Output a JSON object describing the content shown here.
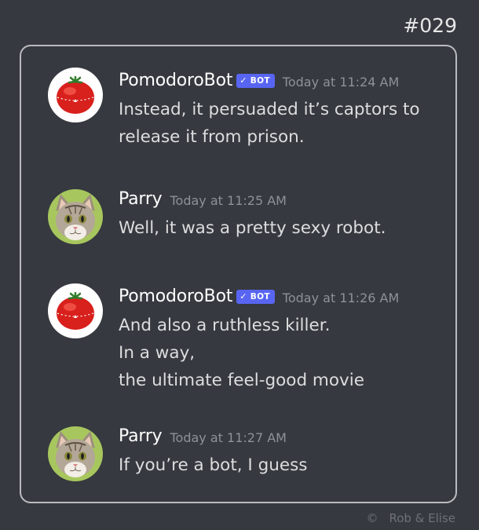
{
  "comic_number": "#029",
  "copyright": {
    "symbol": "©",
    "credit": "Rob & Elise"
  },
  "bot_tag": {
    "check": "✓",
    "label": "BOT"
  },
  "colors": {
    "background": "#36393f",
    "panel_border": "#b9bbbe",
    "bot_tag": "#5865f2",
    "timestamp": "#8e9297",
    "message_text": "#dcddde"
  },
  "messages": [
    {
      "author": "PomodoroBot",
      "is_bot": true,
      "avatar": "tomato-timer-avatar",
      "timestamp": "Today at 11:24 AM",
      "lines": [
        "Instead, it persuaded it’s captors to",
        "release it from prison."
      ]
    },
    {
      "author": "Parry",
      "is_bot": false,
      "avatar": "kitten-avatar",
      "timestamp": "Today at 11:25 AM",
      "lines": [
        "Well, it was a pretty sexy robot."
      ]
    },
    {
      "author": "PomodoroBot",
      "is_bot": true,
      "avatar": "tomato-timer-avatar",
      "timestamp": "Today at 11:26 AM",
      "lines": [
        "And also a ruthless killer.",
        "In a way,",
        "the ultimate feel-good movie"
      ]
    },
    {
      "author": "Parry",
      "is_bot": false,
      "avatar": "kitten-avatar",
      "timestamp": "Today at 11:27 AM",
      "lines": [
        "If you’re a bot, I guess"
      ]
    }
  ]
}
